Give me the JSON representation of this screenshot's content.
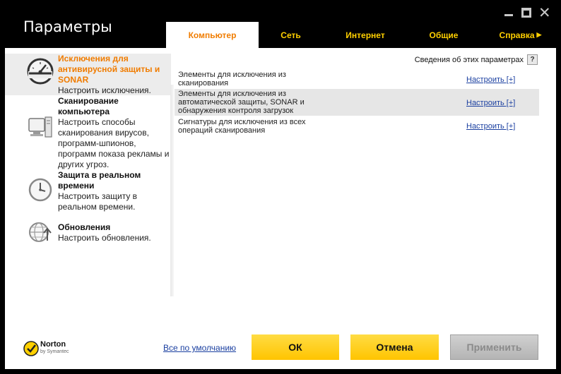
{
  "window": {
    "title": "Параметры"
  },
  "tabs": [
    {
      "label": "Компьютер",
      "active": true
    },
    {
      "label": "Сеть",
      "active": false
    },
    {
      "label": "Интернет",
      "active": false
    },
    {
      "label": "Общие",
      "active": false
    },
    {
      "label": "Справка",
      "active": false
    }
  ],
  "sidebar": {
    "items": [
      {
        "title": "Исключения для антивирусной защиты и SONAR",
        "desc": "Настроить исключения.",
        "icon": "gauge-icon",
        "selected": true
      },
      {
        "title": "Сканирование компьютера",
        "desc": "Настроить способы сканирования вирусов, программ-шпионов, программ показа рекламы и других угроз.",
        "icon": "computer-icon",
        "selected": false
      },
      {
        "title": "Защита в реальном времени",
        "desc": "Настроить защиту в реальном времени.",
        "icon": "clock-icon",
        "selected": false
      },
      {
        "title": "Обновления",
        "desc": "Настроить обновления.",
        "icon": "globe-update-icon",
        "selected": false
      }
    ]
  },
  "main": {
    "about_label": "Сведения об этих параметрах",
    "help_glyph": "?",
    "rows": [
      {
        "label": "Элементы для исключения из сканирования",
        "action": "Настроить [+]"
      },
      {
        "label": "Элементы для исключения из автоматической защиты, SONAR и обнаружения контроля загрузок",
        "action": "Настроить [+]"
      },
      {
        "label": "Сигнатуры для исключения из всех операций сканирования",
        "action": "Настроить [+]"
      }
    ]
  },
  "footer": {
    "logo_text": "Norton",
    "logo_sub": "by Symantec",
    "defaults_link": "Все по умолчанию",
    "ok_label": "ОК",
    "cancel_label": "Отмена",
    "apply_label": "Применить"
  },
  "colors": {
    "accent": "#f07c00",
    "tab_text": "#ffd000",
    "button_yellow": "#ffcc00",
    "link_blue": "#1a3fa0"
  }
}
